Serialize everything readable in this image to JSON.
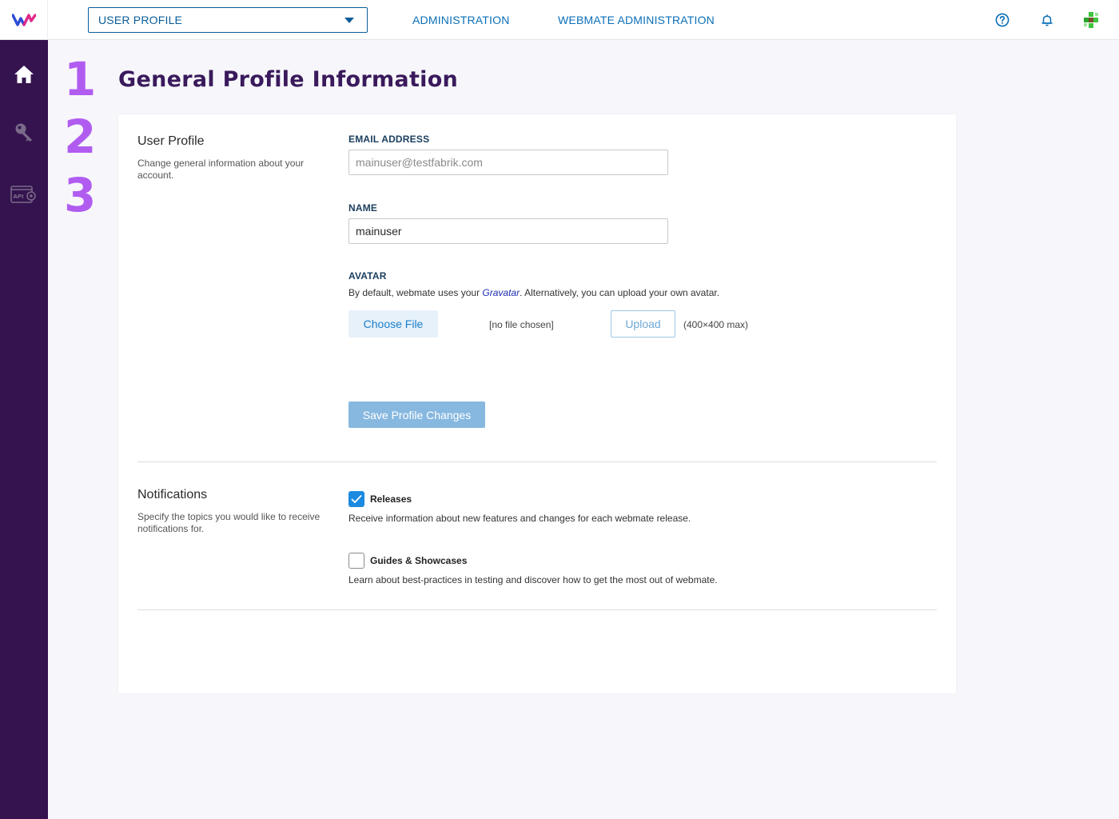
{
  "header": {
    "context_select": "USER PROFILE",
    "nav": [
      "ADMINISTRATION",
      "WEBMATE ADMINISTRATION"
    ],
    "icons": [
      "help-icon",
      "bell-icon",
      "user-avatar-icon"
    ]
  },
  "sidebar": {
    "items": [
      {
        "icon": "home-icon"
      },
      {
        "icon": "key-icon"
      },
      {
        "icon": "api-settings-icon"
      }
    ]
  },
  "steps": [
    "1",
    "2",
    "3"
  ],
  "page": {
    "title": "General Profile Information"
  },
  "profile_section": {
    "title": "User Profile",
    "description": "Change general information about your account.",
    "email_label": "EMAIL ADDRESS",
    "email_value": "mainuser@testfabrik.com",
    "name_label": "NAME",
    "name_value": "mainuser",
    "avatar_label": "AVATAR",
    "avatar_desc_prefix": "By default, webmate uses your ",
    "avatar_desc_link": "Gravatar",
    "avatar_desc_suffix": ". Alternatively, you can upload your own avatar.",
    "choose_file_label": "Choose File",
    "no_file_text": "[no file chosen]",
    "upload_label": "Upload",
    "max_size_note": "(400×400 max)",
    "save_label": "Save Profile Changes"
  },
  "notifications_section": {
    "title": "Notifications",
    "description": "Specify the topics you would like to receive notifications for.",
    "options": [
      {
        "label": "Releases",
        "checked": true,
        "description": "Receive information about new features and changes for each webmate release."
      },
      {
        "label": "Guides & Showcases",
        "checked": false,
        "description": "Learn about best-practices in testing and discover how to get the most out of webmate."
      }
    ]
  },
  "colors": {
    "sidebar_bg": "#34134f",
    "accent": "#1b8ae0",
    "title": "#3a1a5c",
    "step": "#b15cf0"
  }
}
